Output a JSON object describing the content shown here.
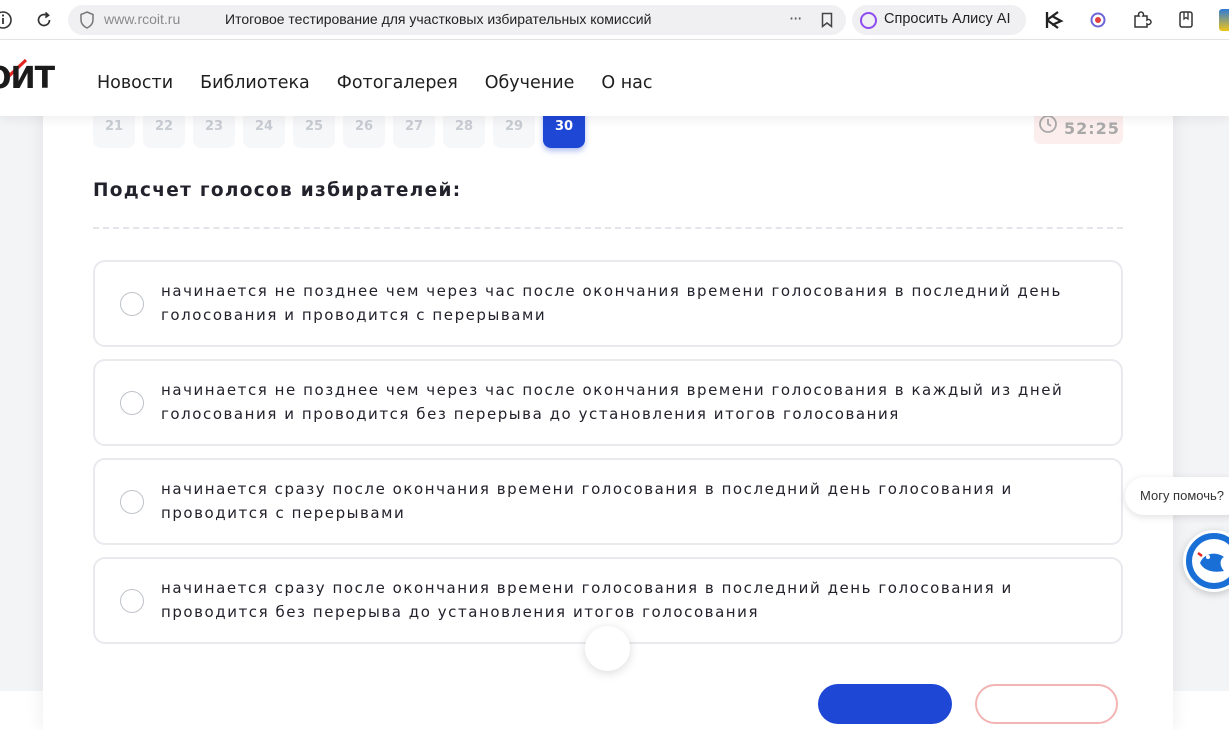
{
  "browser": {
    "domain": "www.rcoit.ru",
    "tab_title": "Итоговое тестирование для участковых избирательных комиссий",
    "more_label": "···",
    "alice_label": "Спросить Алису AI"
  },
  "site": {
    "logo": "ОИТ",
    "nav": [
      "Новости",
      "Библиотека",
      "Фотогалерея",
      "Обучение",
      "О нас"
    ]
  },
  "test": {
    "question_numbers": [
      "21",
      "22",
      "23",
      "24",
      "25",
      "26",
      "27",
      "28",
      "29",
      "30"
    ],
    "active_question": "30",
    "timer": "52:25",
    "question": "Подсчет голосов избирателей:",
    "answers": [
      "начинается не позднее чем через час после окончания времени голосования в последний день голосования и проводится с перерывами",
      "начинается не позднее чем через час после окончания времени голосования в каждый из дней голосования и проводится без перерыва до установления итогов голосования",
      "начинается сразу после окончания времени голосования в последний день голосования и проводится с перерывами",
      "начинается сразу после окончания времени голосования в последний день голосования и проводится без перерыва до установления итогов голосования"
    ]
  },
  "assistant": {
    "bubble_text": "Могу помочь?"
  },
  "colors": {
    "accent": "#1f47d6",
    "timer_bg": "#fdeeee",
    "alice": "#8f4cf0",
    "logo_check": "#e2261f"
  },
  "icons": [
    "info-icon",
    "reload-icon",
    "shield-icon",
    "bookmark-icon",
    "alice-icon",
    "extension-k-icon",
    "extension-circle-icon",
    "puzzle-icon",
    "collections-icon",
    "clock-icon",
    "assistant-avatar-icon"
  ]
}
